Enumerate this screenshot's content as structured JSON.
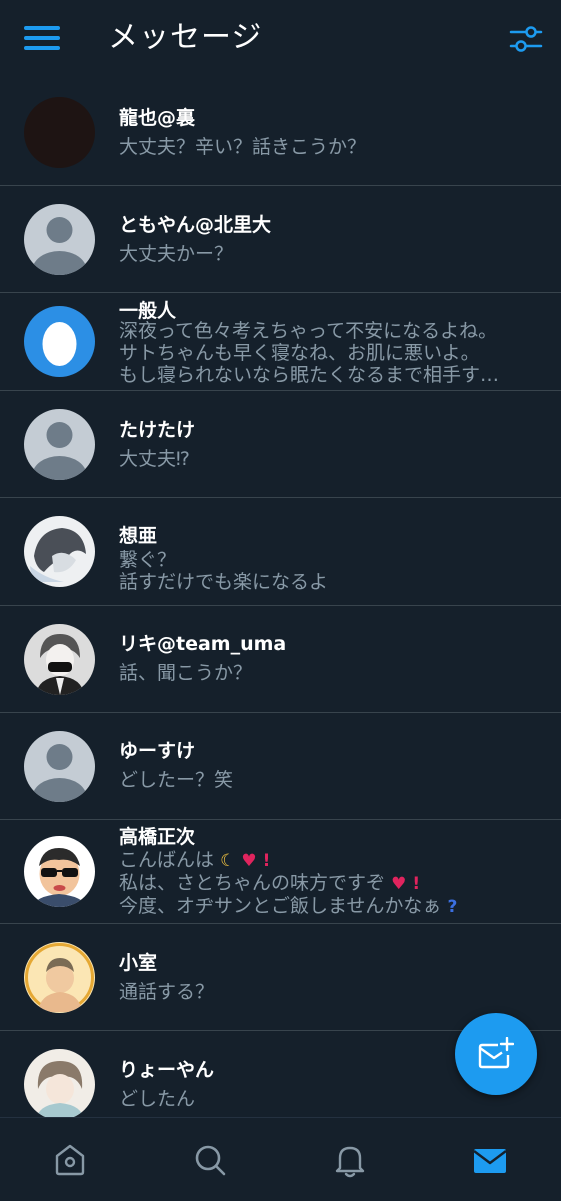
{
  "header": {
    "title": "メッセージ"
  },
  "colors": {
    "background": "#15202b",
    "accent": "#1d9bf0",
    "divider": "#38444d",
    "secondary_text": "#8899a6"
  },
  "conversations": [
    {
      "name": "龍也@裏",
      "lines": [
        "大丈夫？辛い？話きこうか？"
      ]
    },
    {
      "name": "ともやん@北里大",
      "lines": [
        "大丈夫かー？"
      ]
    },
    {
      "name": "一般人",
      "lines": [
        "深夜って色々考えちゃって不安になるよね。",
        "サトちゃんも早く寝なね、お肌に悪いよ。",
        "もし寝られないなら眠たくなるまで相手す…"
      ]
    },
    {
      "name": "たけたけ",
      "lines": [
        "大丈夫⁉"
      ]
    },
    {
      "name": "想亜",
      "lines": [
        "繋ぐ？",
        "話すだけでも楽になるよ"
      ]
    },
    {
      "name": "リキ@team_uma",
      "lines": [
        "話、聞こうか？"
      ]
    },
    {
      "name": "ゆーすけ",
      "lines": [
        "どしたー？笑"
      ]
    },
    {
      "name": "高橋正次",
      "lines": [
        "こんばんは",
        "私は、さとちゃんの味方ですぞ",
        "今度、オヂサンとご飯しませんかなぁ"
      ]
    },
    {
      "name": "小室",
      "lines": [
        "通話する？"
      ]
    },
    {
      "name": "りょーやん",
      "lines": [
        "どしたん"
      ]
    }
  ],
  "icons": {
    "menu": "hamburger-menu-icon",
    "filter": "settings-sliders-icon",
    "compose": "new-message-icon",
    "nav": [
      "home-icon",
      "search-icon",
      "bell-icon",
      "mail-icon"
    ]
  }
}
